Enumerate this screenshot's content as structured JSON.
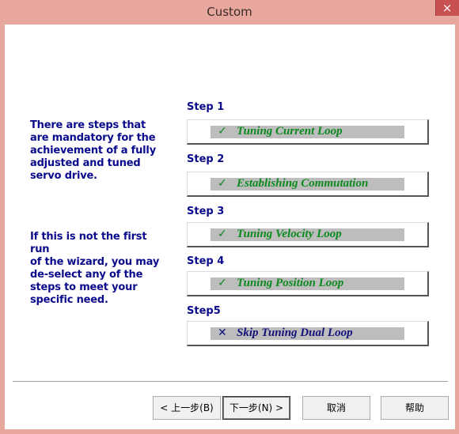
{
  "window": {
    "title": "Custom"
  },
  "intro": {
    "paragraph1": [
      "There are steps that",
      "are mandatory for the",
      "achievement of a fully",
      "adjusted and tuned",
      "servo drive."
    ],
    "paragraph2": [
      "If this is not the first run",
      "of the wizard, you may",
      "de-select any of the",
      "steps to meet your",
      "specific need."
    ]
  },
  "steps": [
    {
      "label": "Step 1",
      "text": "Tuning Current Loop",
      "icon": "check-icon",
      "status": "✓"
    },
    {
      "label": "Step 2",
      "text": "Establishing Commutation",
      "icon": "check-icon",
      "status": "✓"
    },
    {
      "label": "Step 3",
      "text": "Tuning Velocity Loop",
      "icon": "check-icon",
      "status": "✓"
    },
    {
      "label": "Step 4",
      "text": "Tuning Position Loop",
      "icon": "check-icon",
      "status": "✓"
    },
    {
      "label": "Step5",
      "text": "Skip Tuning Dual Loop",
      "icon": "cross-icon",
      "status": "✕"
    }
  ],
  "buttons": {
    "back": "< 上一步(B)",
    "next": "下一步(N) >",
    "cancel": "取消",
    "help": "帮助"
  },
  "colors": {
    "titlebar": "#e8a79c",
    "text_blue": "#0a0a8c",
    "check_green": "#0b8a1e",
    "close_red": "#c75050"
  }
}
